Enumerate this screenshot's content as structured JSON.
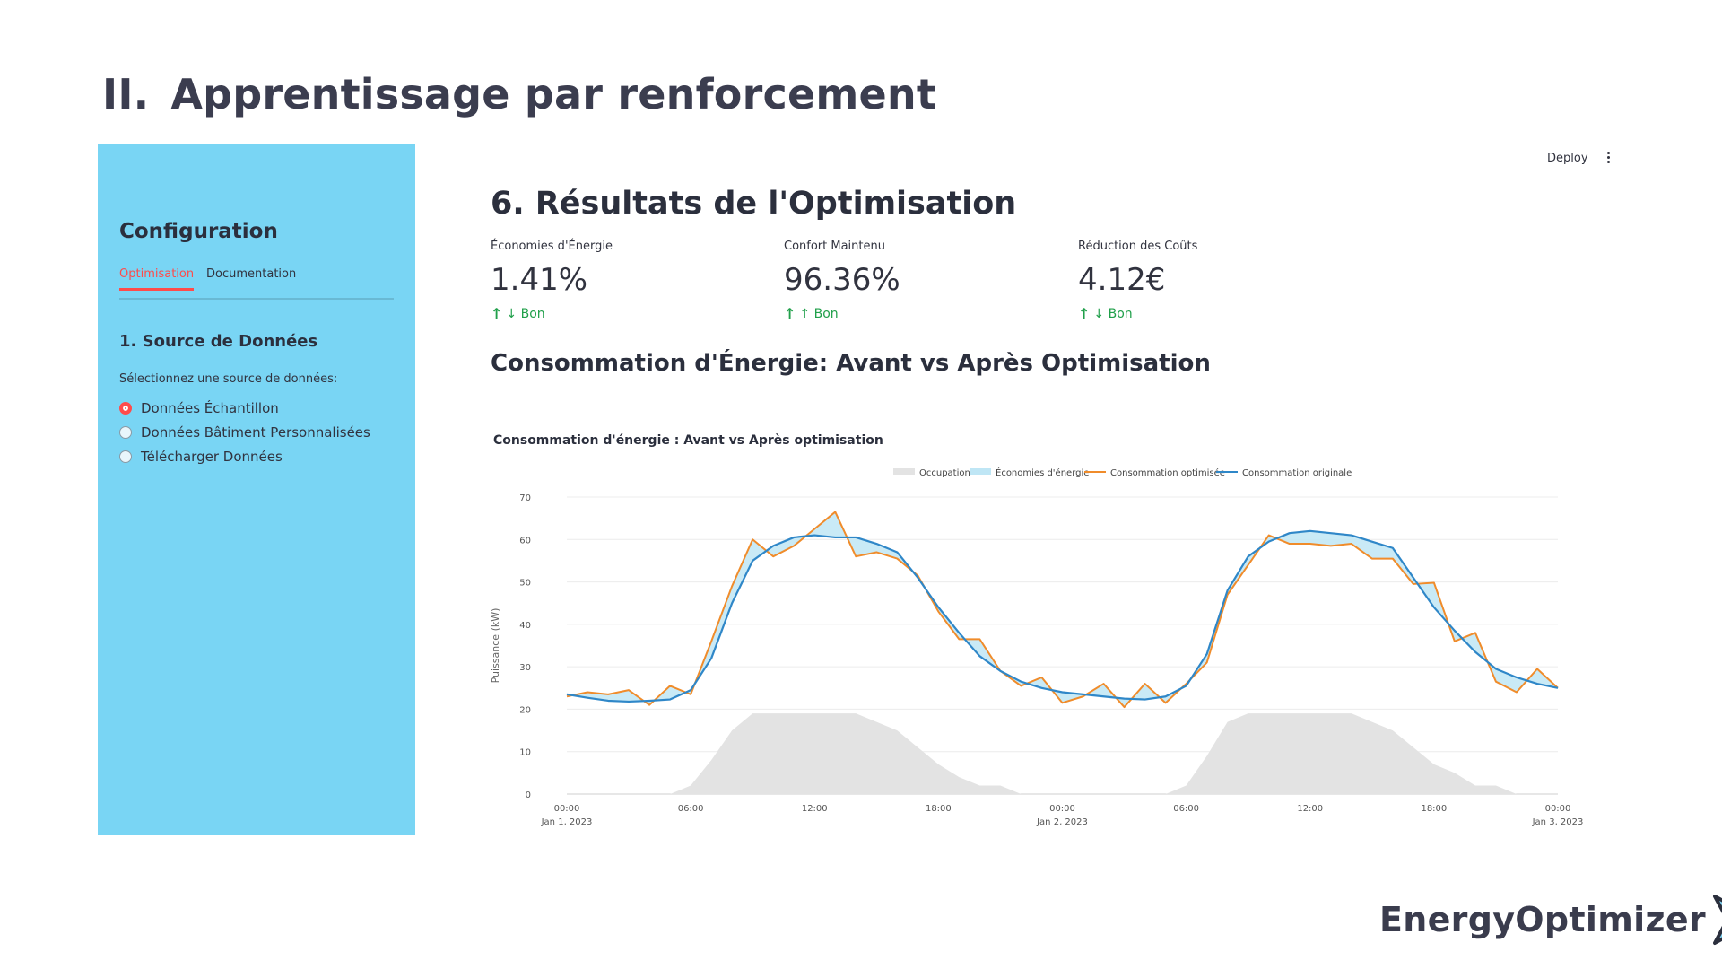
{
  "slide": {
    "number": "II.",
    "title": "Apprentissage par renforcement"
  },
  "sidebar": {
    "heading": "Configuration",
    "tabs": [
      "Optimisation",
      "Documentation"
    ],
    "active_tab": "Optimisation",
    "section_title": "1. Source de Données",
    "prompt": "Sélectionnez une source de données:",
    "options": [
      "Données Échantillon",
      "Données Bâtiment Personnalisées",
      "Télécharger Données"
    ],
    "selected_option": "Données Échantillon",
    "background_color": "#79d5f4"
  },
  "header": {
    "deploy_label": "Deploy",
    "menu_icon": "more-vertical-icon"
  },
  "main": {
    "title": "6. Résultats de l'Optimisation",
    "metrics": [
      {
        "label": "Économies d'Énergie",
        "value": "1.41%",
        "delta": "↓ Bon"
      },
      {
        "label": "Confort Maintenu",
        "value": "96.36%",
        "delta": "↑ Bon"
      },
      {
        "label": "Réduction des Coûts",
        "value": "4.12€",
        "delta": "↓ Bon"
      }
    ],
    "delta_color": "#21a04b",
    "chart_heading": "Consommation d'Énergie: Avant vs Après Optimisation"
  },
  "chart_data": {
    "type": "line",
    "title": "Consommation d'énergie : Avant vs Après optimisation",
    "ylabel": "Puissance (kW)",
    "ylim": [
      0,
      70
    ],
    "yticks": [
      0,
      10,
      20,
      30,
      40,
      50,
      60,
      70
    ],
    "xlim_hours": [
      0,
      48
    ],
    "x_tick_labels": [
      {
        "hour": 0,
        "label": "00:00",
        "date": "Jan 1, 2023"
      },
      {
        "hour": 6,
        "label": "06:00"
      },
      {
        "hour": 12,
        "label": "12:00"
      },
      {
        "hour": 18,
        "label": "18:00"
      },
      {
        "hour": 24,
        "label": "00:00",
        "date": "Jan 2, 2023"
      },
      {
        "hour": 30,
        "label": "06:00"
      },
      {
        "hour": 36,
        "label": "12:00"
      },
      {
        "hour": 42,
        "label": "18:00"
      },
      {
        "hour": 48,
        "label": "00:00",
        "date": "Jan 3, 2023"
      }
    ],
    "x_hours": [
      0,
      1,
      2,
      3,
      4,
      5,
      6,
      7,
      8,
      9,
      10,
      11,
      12,
      13,
      14,
      15,
      16,
      17,
      18,
      19,
      20,
      21,
      22,
      23,
      24,
      25,
      26,
      27,
      28,
      29,
      30,
      31,
      32,
      33,
      34,
      35,
      36,
      37,
      38,
      39,
      40,
      41,
      42,
      43,
      44,
      45,
      46,
      47,
      48
    ],
    "series": [
      {
        "name": "Occupation",
        "color": "#e3e3e3",
        "values": [
          0,
          0,
          0,
          0,
          0,
          0,
          2,
          8,
          15,
          19,
          19,
          19,
          19,
          19,
          19,
          17,
          15,
          11,
          7,
          4,
          2,
          2,
          0,
          0,
          0,
          0,
          0,
          0,
          0,
          0,
          2,
          9,
          17,
          19,
          19,
          19,
          19,
          19,
          19,
          17,
          15,
          11,
          7,
          5,
          2,
          2,
          0,
          0,
          0
        ]
      },
      {
        "name": "Consommation optimisée",
        "color": "#f08c2b",
        "values": [
          23,
          24,
          23.5,
          24.5,
          21,
          25.5,
          23.5,
          36,
          49,
          60,
          56,
          58.5,
          62.5,
          66.5,
          56,
          57,
          55.5,
          51.5,
          43,
          36.5,
          36.5,
          29,
          25.5,
          27.5,
          21.5,
          23,
          26,
          20.5,
          26,
          21.5,
          26,
          31,
          47,
          54,
          61,
          59,
          59,
          58.5,
          59,
          55.5,
          55.5,
          49.5,
          49.8,
          36,
          38,
          26.5,
          24,
          29.5,
          25
        ]
      },
      {
        "name": "Consommation originale",
        "color": "#2f87c8",
        "values": [
          23.5,
          22.7,
          22,
          21.8,
          22,
          22.3,
          24.5,
          32,
          45,
          55,
          58.5,
          60.5,
          61,
          60.5,
          60.5,
          59,
          57,
          51,
          44,
          38,
          32.5,
          29,
          26.5,
          25,
          24,
          23.5,
          23,
          22.5,
          22.3,
          23,
          25.5,
          33,
          48,
          56,
          59.5,
          61.5,
          62,
          61.5,
          61,
          59.5,
          58,
          51,
          44,
          38.5,
          33.5,
          29.5,
          27.5,
          26,
          25
        ]
      }
    ],
    "fill": {
      "name": "Économies d'énergie",
      "color": "#bfe6f5",
      "between": [
        "Consommation originale",
        "Consommation optimisée"
      ]
    },
    "legend": [
      "Occupation",
      "Économies d'énergie",
      "Consommation optimisée",
      "Consommation originale"
    ],
    "legend_position": "top-right",
    "grid": true
  },
  "logo": {
    "text": "EnergyOptimizer",
    "icon": "arrow-chevron-icon"
  }
}
